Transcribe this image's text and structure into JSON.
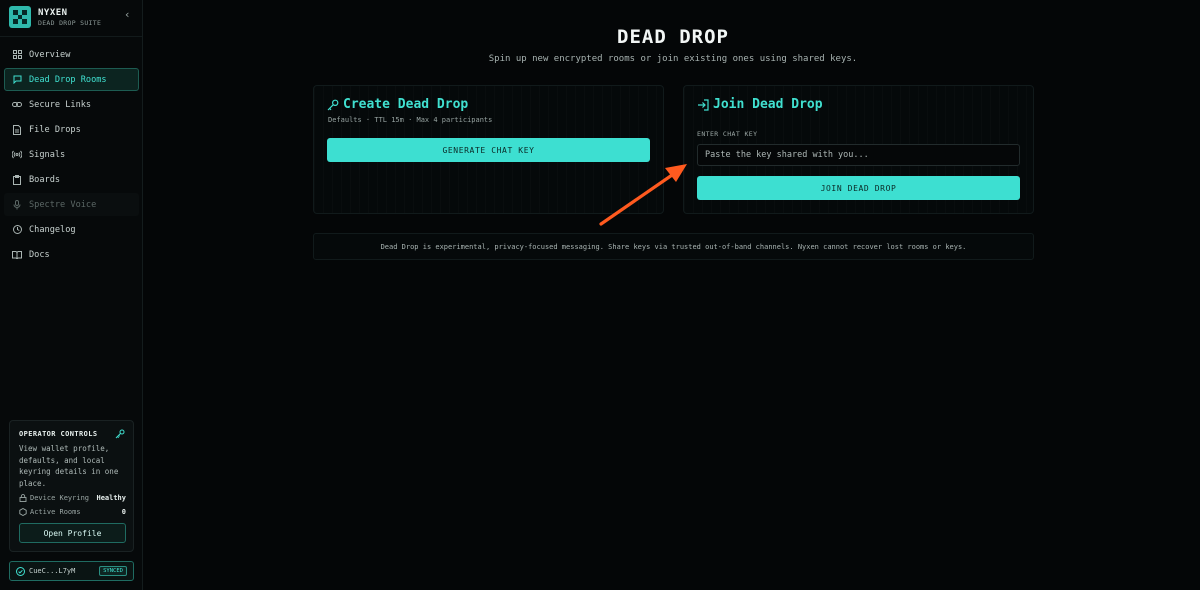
{
  "brand": {
    "name": "NYXEN",
    "subtitle": "DEAD DROP SUITE"
  },
  "sidebar": {
    "items": [
      {
        "label": "Overview",
        "icon": "grid-icon"
      },
      {
        "label": "Dead Drop Rooms",
        "icon": "chat-icon",
        "active": true
      },
      {
        "label": "Secure Links",
        "icon": "link-icon"
      },
      {
        "label": "File Drops",
        "icon": "file-icon"
      },
      {
        "label": "Signals",
        "icon": "broadcast-icon"
      },
      {
        "label": "Boards",
        "icon": "clipboard-icon"
      },
      {
        "label": "Spectre Voice",
        "icon": "mic-icon",
        "disabled": true
      },
      {
        "label": "Changelog",
        "icon": "clock-icon"
      },
      {
        "label": "Docs",
        "icon": "book-icon"
      }
    ]
  },
  "operator": {
    "title": "OPERATOR CONTROLS",
    "description": "View wallet profile, defaults, and local keyring details in one place.",
    "keyring_label": "Device Keyring",
    "keyring_value": "Healthy",
    "rooms_label": "Active Rooms",
    "rooms_value": "0",
    "button": "Open Profile"
  },
  "wallet": {
    "address": "CueC...L7yM",
    "status": "SYNCED"
  },
  "main": {
    "title": "DEAD DROP",
    "subtitle": "Spin up new encrypted rooms or join existing ones using shared keys.",
    "create": {
      "title": "Create Dead Drop",
      "meta": "Defaults · TTL 15m · Max 4 participants",
      "button": "GENERATE CHAT KEY"
    },
    "join": {
      "title": "Join Dead Drop",
      "field_label": "ENTER CHAT KEY",
      "placeholder": "Paste the key shared with you...",
      "value": "",
      "button": "JOIN DEAD DROP"
    },
    "notice": "Dead Drop is experimental, privacy-focused messaging. Share keys via trusted out-of-band channels. Nyxen cannot recover lost rooms or keys."
  },
  "colors": {
    "accent": "#40E0D0",
    "annotation_arrow": "#FF5A1F",
    "background": "#040607"
  }
}
